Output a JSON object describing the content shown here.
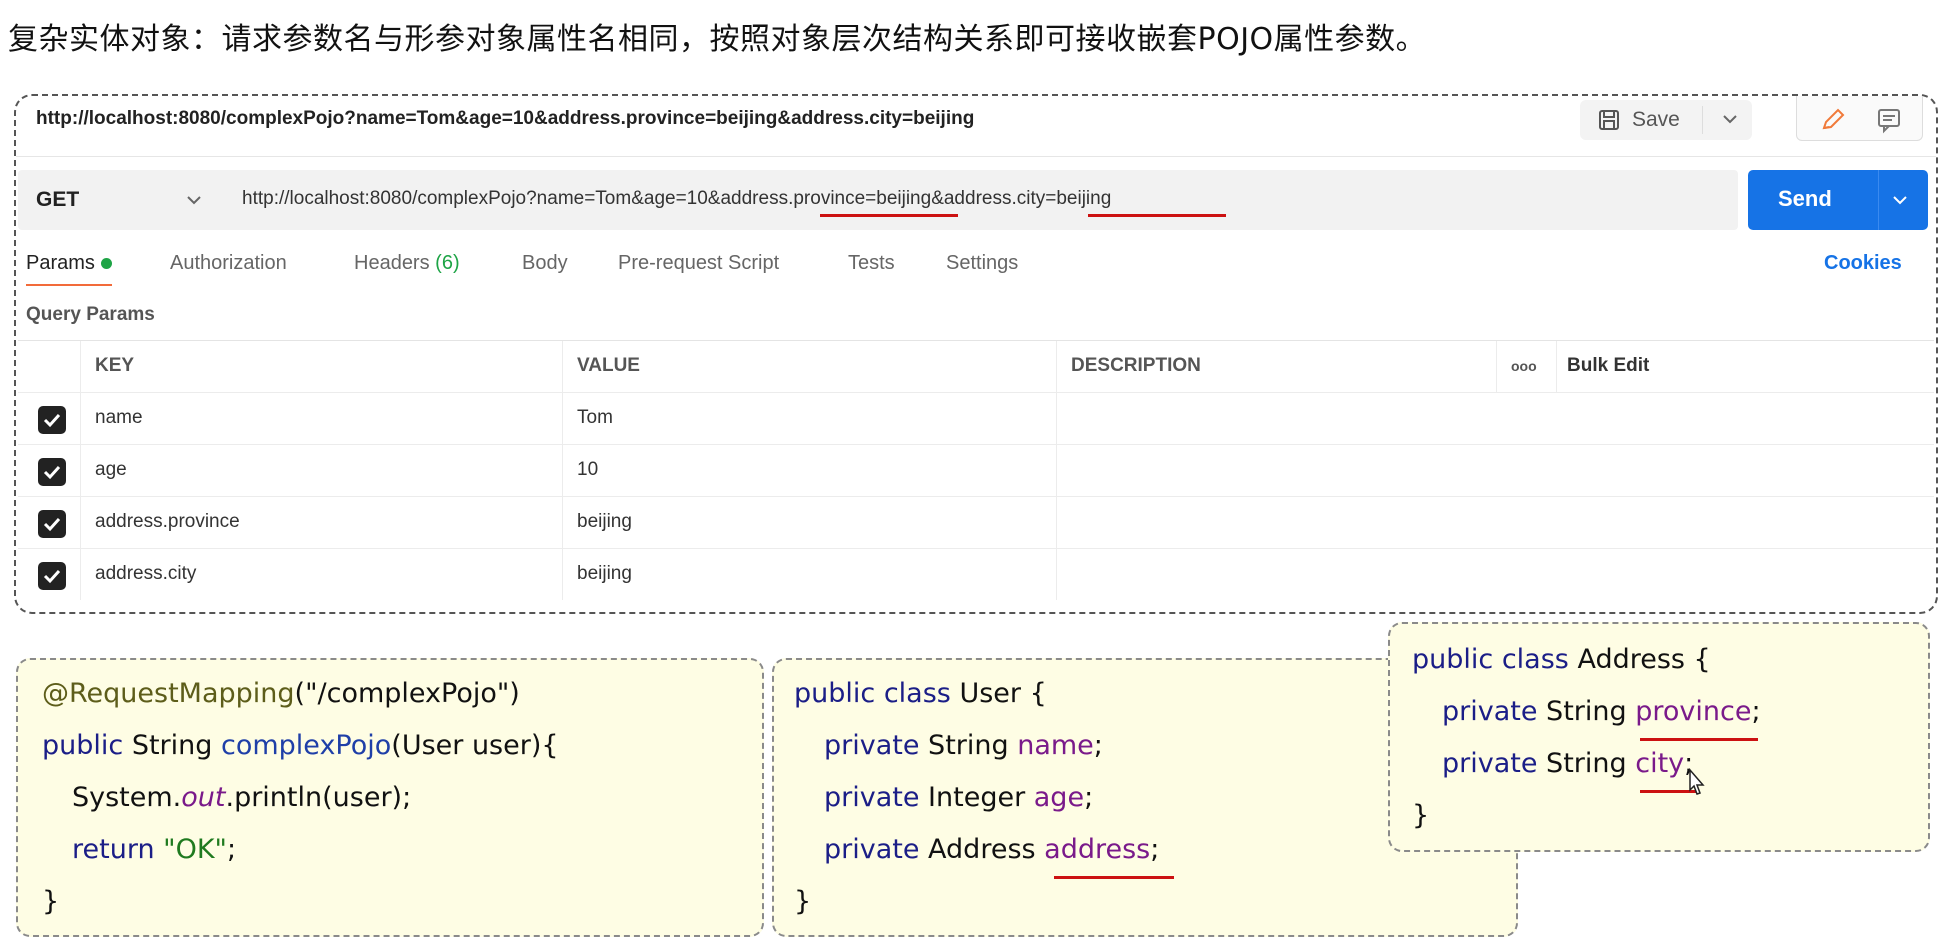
{
  "heading": "复杂实体对象：请求参数名与形参对象属性名相同，按照对象层次结构关系即可接收嵌套POJO属性参数。",
  "request": {
    "title_url": "http://localhost:8080/complexPojo?name=Tom&age=10&address.province=beijing&address.city=beijing",
    "save_label": "Save",
    "method": "GET",
    "url": "http://localhost:8080/complexPojo?name=Tom&age=10&address.province=beijing&address.city=beijing",
    "send_label": "Send"
  },
  "tabs": [
    {
      "label": "Params",
      "active": true
    },
    {
      "label": "Authorization"
    },
    {
      "label": "Headers",
      "count": "(6)"
    },
    {
      "label": "Body"
    },
    {
      "label": "Pre-request Script"
    },
    {
      "label": "Tests"
    },
    {
      "label": "Settings"
    }
  ],
  "cookies_label": "Cookies",
  "query_params_label": "Query Params",
  "table": {
    "headers": {
      "key": "KEY",
      "value": "VALUE",
      "description": "DESCRIPTION",
      "more": "ooo",
      "bulk_edit": "Bulk Edit"
    },
    "rows": [
      {
        "checked": true,
        "key": "name",
        "value": "Tom"
      },
      {
        "checked": true,
        "key": "age",
        "value": "10"
      },
      {
        "checked": true,
        "key": "address.province",
        "value": "beijing"
      },
      {
        "checked": true,
        "key": "address.city",
        "value": "beijing"
      }
    ]
  },
  "code": {
    "controller": {
      "annotation": "@RequestMapping",
      "path": "(\"/complexPojo\")",
      "kw_public": "public",
      "sig_rest": " String ",
      "method_name": "complexPojo",
      "params": "(User user){",
      "sys": "System.",
      "out": "out",
      "println": ".println(user);",
      "kw_return": "return",
      "ok": " \"OK\"",
      "semi": ";",
      "close": "}"
    },
    "user": {
      "kw": "public class",
      "name": " User {",
      "f1_kw": "private",
      "f1_type": " String ",
      "f1_name": "name",
      "f2_kw": "private",
      "f2_type": " Integer ",
      "f2_name": "age",
      "f3_kw": "private",
      "f3_type": " Address ",
      "f3_name": "address",
      "semi": ";",
      "close": "}"
    },
    "address": {
      "kw": "public class",
      "name": " Address {",
      "f1_kw": "private",
      "f1_type": " String ",
      "f1_name": "province",
      "f2_kw": "private",
      "f2_type": " String ",
      "f2_name": "city",
      "semi": ";",
      "close": "}"
    }
  },
  "accent_colors": {
    "send": "#1673e6",
    "underline": "#cc1111",
    "active_tab": "#f26b3a",
    "code_bg": "#fefde4"
  }
}
